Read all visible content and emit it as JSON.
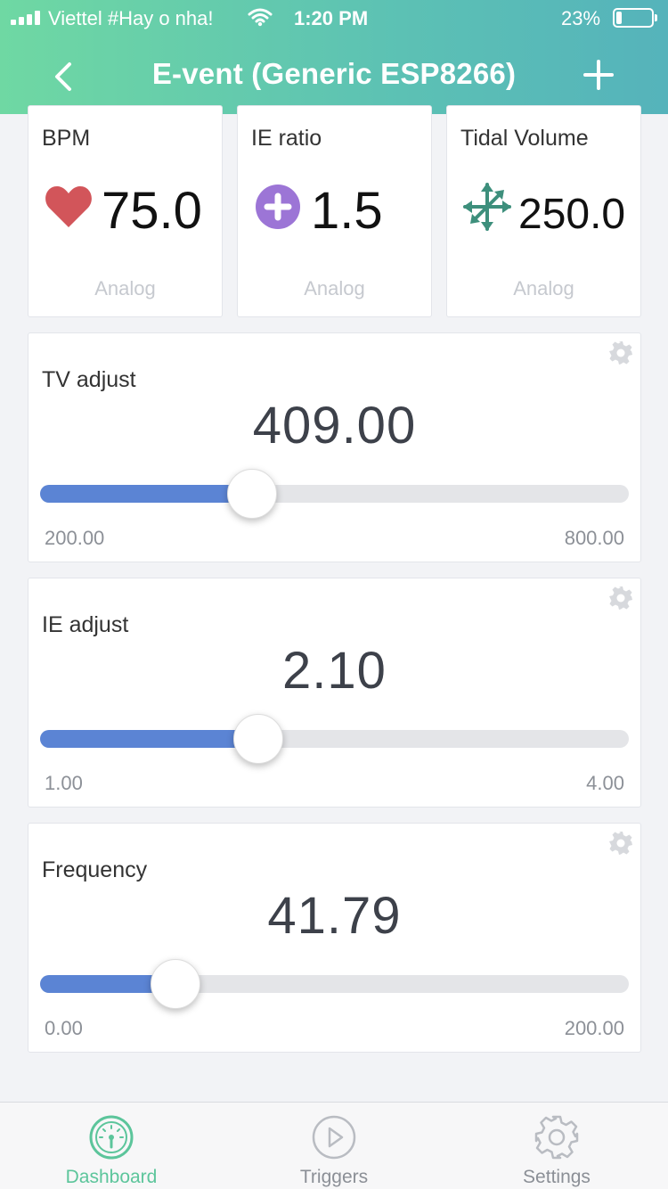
{
  "status_bar": {
    "carrier": "Viettel #Hay o nha!",
    "time": "1:20 PM",
    "battery_percent": "23%",
    "battery_level": 0.23
  },
  "nav": {
    "title": "E-vent (Generic ESP8266)",
    "back_icon": "chevron-left-icon",
    "add_icon": "plus-icon"
  },
  "value_widgets": [
    {
      "label": "BPM",
      "value": "75.0",
      "icon": "heart-icon",
      "icon_color": "#d2555a",
      "footer": "Analog"
    },
    {
      "label": "IE ratio",
      "value": "1.5",
      "icon": "plus-circle-icon",
      "icon_color": "#9c75d6",
      "footer": "Analog"
    },
    {
      "label": "Tidal Volume",
      "value": "250.0",
      "icon": "arrows-expand-icon",
      "icon_color": "#3d8f7c",
      "footer": "Analog"
    }
  ],
  "sliders": [
    {
      "title": "TV adjust",
      "value": "409.00",
      "min": "200.00",
      "max": "800.00",
      "fraction": 0.36
    },
    {
      "title": "IE adjust",
      "value": "2.10",
      "min": "1.00",
      "max": "4.00",
      "fraction": 0.37
    },
    {
      "title": "Frequency",
      "value": "41.79",
      "min": "0.00",
      "max": "200.00",
      "fraction": 0.23
    }
  ],
  "tabs": [
    {
      "label": "Dashboard",
      "icon": "gauge-icon",
      "active": true
    },
    {
      "label": "Triggers",
      "icon": "play-circle-icon",
      "active": false
    },
    {
      "label": "Settings",
      "icon": "gear-icon",
      "active": false
    }
  ],
  "colors": {
    "header_start": "#6fd8a3",
    "header_end": "#55b3bb",
    "slider_fill": "#5b84d4",
    "active_tab": "#5cc59b"
  }
}
